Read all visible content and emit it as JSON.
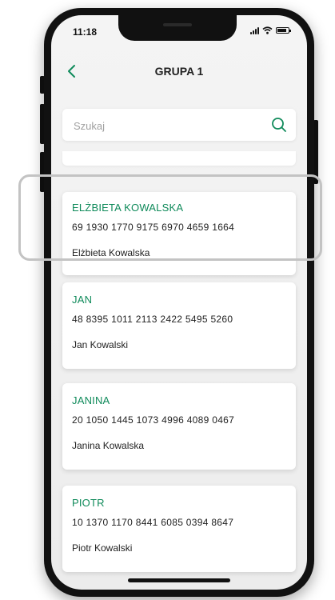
{
  "status_bar": {
    "time": "11:18"
  },
  "header": {
    "title": "GRUPA 1"
  },
  "search": {
    "placeholder": "Szukaj",
    "value": ""
  },
  "contacts": [
    {
      "alias": "ELŻBIETA KOWALSKA",
      "account": "69 1930 1770 9175 6970 4659 1664",
      "recipient": "Elżbieta Kowalska"
    },
    {
      "alias": "JAN",
      "account": "48 8395 1011 2113 2422 5495 5260",
      "recipient": "Jan Kowalski"
    },
    {
      "alias": "JANINA",
      "account": "20 1050 1445 1073 4996 4089 0467",
      "recipient": "Janina Kowalska"
    },
    {
      "alias": "PIOTR",
      "account": "10 1370 1170 8441 6085 0394 8647",
      "recipient": "Piotr Kowalski"
    }
  ],
  "colors": {
    "accent": "#0f8a5a",
    "highlight_frame": "#c3c3c3",
    "background": "#f0f0f0"
  },
  "icons": {
    "back": "chevron-left-icon",
    "search": "search-icon"
  }
}
